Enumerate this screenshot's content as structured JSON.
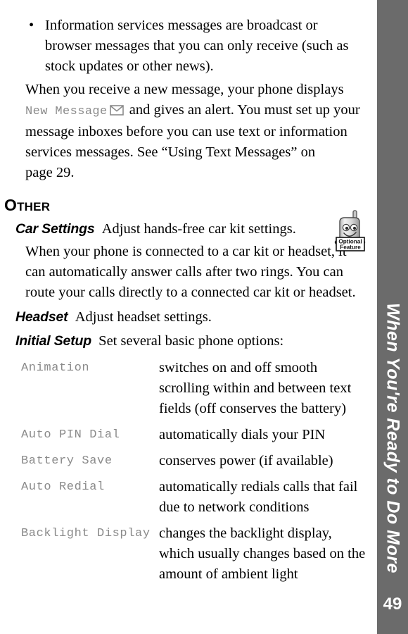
{
  "page": {
    "number": "49",
    "sidebar_title": "When You're Ready to Do More",
    "sidebar_color": "#6b6b6b",
    "screen_text_color": "#8a8a8a"
  },
  "bullets": [
    {
      "marker": "•",
      "text": "Information services messages are broadcast or browser messages that you can only receive (such as stock updates or other news)."
    }
  ],
  "paragraphs": {
    "new_message": {
      "part1": "When you receive a new message, your phone displays ",
      "screen1": "New Message",
      "icon": "envelope-icon",
      "part2": " and gives an alert. You must set up your message inboxes before you can use text or information services messages. See “Using Text Messages” on page 29."
    },
    "car_settings_body": "When your phone is connected to a car kit or headset, it can automatically answer calls after two rings. You can route your calls directly to a connected car kit or headset."
  },
  "section": {
    "heading_first": "O",
    "heading_rest": "THER"
  },
  "definitions": [
    {
      "term": "Car Settings",
      "desc": "Adjust hands-free car kit settings."
    },
    {
      "term": "Headset",
      "desc": "Adjust headset settings."
    },
    {
      "term": "Initial Setup",
      "desc": "Set several basic phone options:"
    }
  ],
  "optional_badge": {
    "line1": "Optional",
    "line2": "Feature",
    "icon": "phone-character-icon"
  },
  "options": [
    {
      "name": "Animation",
      "desc": "switches on and off smooth scrolling within and between text fields (off conserves the battery)"
    },
    {
      "name": "Auto PIN Dial",
      "desc": "automatically dials your PIN"
    },
    {
      "name": "Battery Save",
      "desc": "conserves power (if available)"
    },
    {
      "name": "Auto Redial",
      "desc": "automatically redials calls that fail due to network conditions"
    },
    {
      "name": "Backlight Display",
      "desc": "changes the backlight display, which usually changes based on the amount of ambient light"
    }
  ]
}
